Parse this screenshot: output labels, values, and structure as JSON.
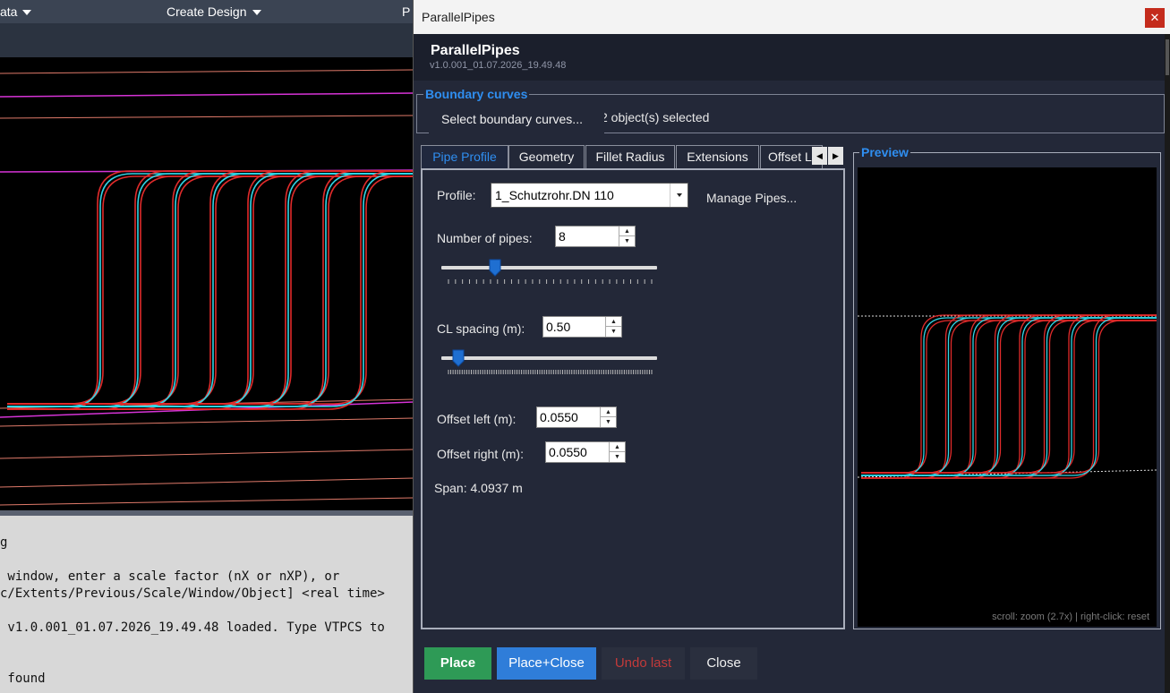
{
  "cad": {
    "menu": [
      {
        "label": "ata"
      },
      {
        "label": "Create Design"
      },
      {
        "label": "P"
      }
    ],
    "command_lines": [
      "g",
      " window, enter a scale factor (nX or nXP), or",
      "c/Extents/Previous/Scale/Window/Object] <real time>",
      " v1.0.001_01.07.2026_19.49.48 loaded. Type VTPCS to",
      " found"
    ]
  },
  "dialog": {
    "window_title": "ParallelPipes",
    "close_glyph": "✕",
    "app_name": "ParallelPipes",
    "version": "v1.0.001_01.07.2026_19.49.48",
    "boundary": {
      "legend": "Boundary curves",
      "select_button": "Select boundary curves...",
      "status": "2 object(s) selected"
    },
    "tabs": [
      {
        "label": "Pipe Profile",
        "active": true
      },
      {
        "label": "Geometry",
        "active": false
      },
      {
        "label": "Fillet Radius",
        "active": false
      },
      {
        "label": "Extensions",
        "active": false
      },
      {
        "label": "Offset L",
        "active": false
      }
    ],
    "tab_scroll": {
      "left": "◀",
      "right": "▶"
    },
    "pipe_profile": {
      "profile_label": "Profile:",
      "profile_value": "1_Schutzrohr.DN 110",
      "manage_link": "Manage Pipes...",
      "num_pipes_label": "Number of pipes:",
      "num_pipes_value": "8",
      "num_pipes_slider_fraction": 0.25,
      "cl_spacing_label": "CL spacing (m):",
      "cl_spacing_value": "0.50",
      "cl_spacing_slider_fraction": 0.08,
      "offset_left_label": "Offset left (m):",
      "offset_left_value": "0.0550",
      "offset_right_label": "Offset right (m):",
      "offset_right_value": "0.0550",
      "span_text": "Span: 4.0937 m"
    },
    "preview": {
      "legend": "Preview",
      "hint": "scroll: zoom (2.7x)  |  right-click: reset"
    },
    "buttons": {
      "place": "Place",
      "place_close": "Place+Close",
      "undo": "Undo last",
      "close": "Close"
    }
  },
  "colors": {
    "accent_blue": "#2f8ef0",
    "place_green": "#2e9a56",
    "undo_red": "#c23a3a",
    "pipe_cyan": "#2fd6e6",
    "pipe_red": "#e02b2b"
  }
}
